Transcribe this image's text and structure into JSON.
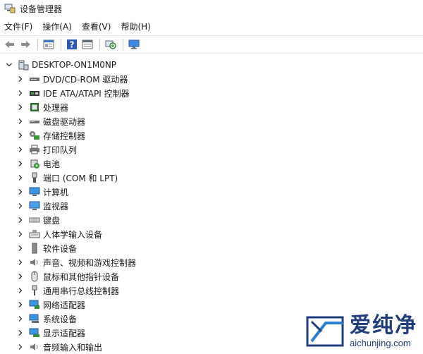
{
  "window": {
    "title": "设备管理器"
  },
  "menu": [
    "文件(F)",
    "操作(A)",
    "查看(V)",
    "帮助(H)"
  ],
  "toolbar": [
    "back-icon",
    "forward-icon",
    "properties-icon",
    "help-icon",
    "view-icon",
    "scan-hardware-icon",
    "monitor-icon"
  ],
  "tree": {
    "root": {
      "label": "DESKTOP-ON1M0NP"
    },
    "items": [
      {
        "label": "DVD/CD-ROM 驱动器",
        "icon": "dvd-drive-icon"
      },
      {
        "label": "IDE ATA/ATAPI 控制器",
        "icon": "ide-controller-icon"
      },
      {
        "label": "处理器",
        "icon": "processor-icon"
      },
      {
        "label": "磁盘驱动器",
        "icon": "disk-drive-icon"
      },
      {
        "label": "存储控制器",
        "icon": "storage-controller-icon"
      },
      {
        "label": "打印队列",
        "icon": "print-queue-icon"
      },
      {
        "label": "电池",
        "icon": "battery-icon"
      },
      {
        "label": "端口 (COM 和 LPT)",
        "icon": "port-icon"
      },
      {
        "label": "计算机",
        "icon": "computer-icon"
      },
      {
        "label": "监视器",
        "icon": "monitor-device-icon"
      },
      {
        "label": "键盘",
        "icon": "keyboard-icon"
      },
      {
        "label": "人体学输入设备",
        "icon": "hid-icon"
      },
      {
        "label": "软件设备",
        "icon": "software-device-icon"
      },
      {
        "label": "声音、视频和游戏控制器",
        "icon": "sound-icon"
      },
      {
        "label": "鼠标和其他指针设备",
        "icon": "mouse-icon"
      },
      {
        "label": "通用串行总线控制器",
        "icon": "usb-icon"
      },
      {
        "label": "网络适配器",
        "icon": "network-adapter-icon"
      },
      {
        "label": "系统设备",
        "icon": "system-device-icon"
      },
      {
        "label": "显示适配器",
        "icon": "display-adapter-icon"
      },
      {
        "label": "音频输入和输出",
        "icon": "audio-io-icon"
      }
    ]
  },
  "watermark": {
    "brand_cn": "爱纯净",
    "brand_url": "aichunjing.com"
  },
  "colors": {
    "accent": "#1f3d7a",
    "icon_blue": "#2a7fd4",
    "icon_gray": "#5a5a5a"
  }
}
